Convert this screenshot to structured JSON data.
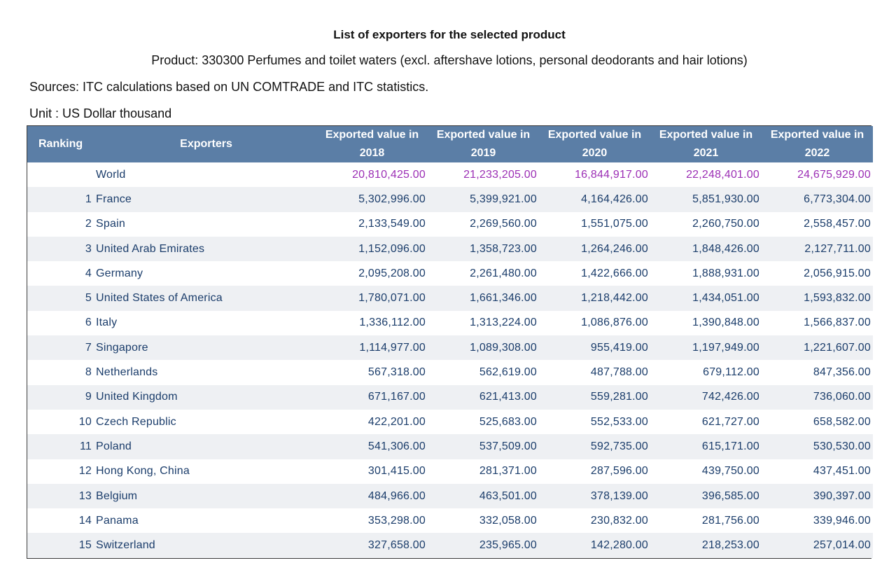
{
  "title": "List of exporters for the selected product",
  "product_line": "Product: 330300 Perfumes and toilet waters (excl. aftershave lotions, personal deodorants and hair lotions)",
  "sources_line": "Sources: ITC calculations based on UN COMTRADE and ITC statistics.",
  "unit_line": "Unit : US Dollar thousand",
  "colors": {
    "header_bg": "#5b7ea6",
    "world_value_color": "#9c2fb5",
    "row_text_color": "#1b3d6b",
    "stripe_bg": "#eef0f3"
  },
  "table": {
    "headers": {
      "ranking": "Ranking",
      "exporters": "Exporters",
      "years": [
        {
          "line1": "Exported value in",
          "line2": "2018"
        },
        {
          "line1": "Exported value in",
          "line2": "2019"
        },
        {
          "line1": "Exported value in",
          "line2": "2020"
        },
        {
          "line1": "Exported value in",
          "line2": "2021"
        },
        {
          "line1": "Exported value in",
          "line2": "2022"
        }
      ]
    },
    "rows": [
      {
        "rank": "",
        "name": "World",
        "values": [
          "20,810,425.00",
          "21,233,205.00",
          "16,844,917.00",
          "22,248,401.00",
          "24,675,929.00"
        ]
      },
      {
        "rank": "1",
        "name": "France",
        "values": [
          "5,302,996.00",
          "5,399,921.00",
          "4,164,426.00",
          "5,851,930.00",
          "6,773,304.00"
        ]
      },
      {
        "rank": "2",
        "name": "Spain",
        "values": [
          "2,133,549.00",
          "2,269,560.00",
          "1,551,075.00",
          "2,260,750.00",
          "2,558,457.00"
        ]
      },
      {
        "rank": "3",
        "name": "United Arab Emirates",
        "values": [
          "1,152,096.00",
          "1,358,723.00",
          "1,264,246.00",
          "1,848,426.00",
          "2,127,711.00"
        ]
      },
      {
        "rank": "4",
        "name": "Germany",
        "values": [
          "2,095,208.00",
          "2,261,480.00",
          "1,422,666.00",
          "1,888,931.00",
          "2,056,915.00"
        ]
      },
      {
        "rank": "5",
        "name": "United States of America",
        "values": [
          "1,780,071.00",
          "1,661,346.00",
          "1,218,442.00",
          "1,434,051.00",
          "1,593,832.00"
        ]
      },
      {
        "rank": "6",
        "name": "Italy",
        "values": [
          "1,336,112.00",
          "1,313,224.00",
          "1,086,876.00",
          "1,390,848.00",
          "1,566,837.00"
        ]
      },
      {
        "rank": "7",
        "name": "Singapore",
        "values": [
          "1,114,977.00",
          "1,089,308.00",
          "955,419.00",
          "1,197,949.00",
          "1,221,607.00"
        ]
      },
      {
        "rank": "8",
        "name": "Netherlands",
        "values": [
          "567,318.00",
          "562,619.00",
          "487,788.00",
          "679,112.00",
          "847,356.00"
        ]
      },
      {
        "rank": "9",
        "name": "United Kingdom",
        "values": [
          "671,167.00",
          "621,413.00",
          "559,281.00",
          "742,426.00",
          "736,060.00"
        ]
      },
      {
        "rank": "10",
        "name": "Czech Republic",
        "values": [
          "422,201.00",
          "525,683.00",
          "552,533.00",
          "621,727.00",
          "658,582.00"
        ]
      },
      {
        "rank": "11",
        "name": "Poland",
        "values": [
          "541,306.00",
          "537,509.00",
          "592,735.00",
          "615,171.00",
          "530,530.00"
        ]
      },
      {
        "rank": "12",
        "name": "Hong Kong, China",
        "values": [
          "301,415.00",
          "281,371.00",
          "287,596.00",
          "439,750.00",
          "437,451.00"
        ]
      },
      {
        "rank": "13",
        "name": "Belgium",
        "values": [
          "484,966.00",
          "463,501.00",
          "378,139.00",
          "396,585.00",
          "390,397.00"
        ]
      },
      {
        "rank": "14",
        "name": "Panama",
        "values": [
          "353,298.00",
          "332,058.00",
          "230,832.00",
          "281,756.00",
          "339,946.00"
        ]
      },
      {
        "rank": "15",
        "name": "Switzerland",
        "values": [
          "327,658.00",
          "235,965.00",
          "142,280.00",
          "218,253.00",
          "257,014.00"
        ]
      }
    ]
  }
}
